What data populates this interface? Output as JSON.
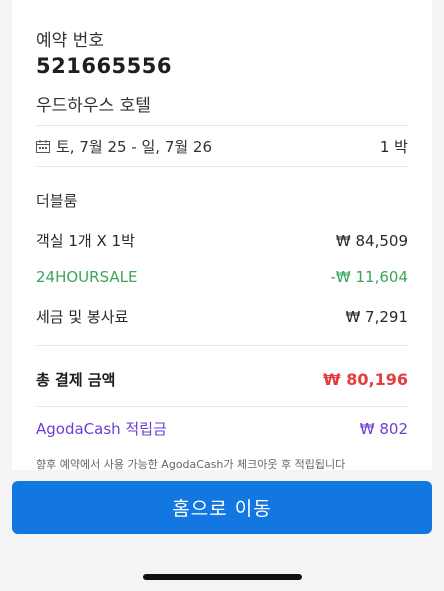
{
  "booking": {
    "label": "예약 번호",
    "number": "521665556",
    "hotel_name": "우드하우스 호텔"
  },
  "stay": {
    "dates": "토, 7월 25 - 일, 7월 26",
    "nights": "1 박",
    "calendar_icon": "calendar-icon"
  },
  "room": {
    "type": "더블룸"
  },
  "pricing": {
    "room_label": "객실 1개 X 1박",
    "room_value": "₩ 84,509",
    "discount_label": "24HOURSALE",
    "discount_value": "-₩ 11,604",
    "tax_label": "세금 및 봉사료",
    "tax_value": "₩ 7,291",
    "total_label": "총 결제 금액",
    "total_value": "₩ 80,196",
    "cash_label": "AgodaCash 적립금",
    "cash_value": "₩ 802",
    "note": "향후 예약에서 사용 가능한 AgodaCash가 체크아웃 후 적립됩니다"
  },
  "actions": {
    "home_button": "홈으로 이동"
  },
  "colors": {
    "accent": "#1277e0",
    "discount": "#3aa55b",
    "total": "#e23e3e",
    "cash": "#6b3fd4"
  }
}
